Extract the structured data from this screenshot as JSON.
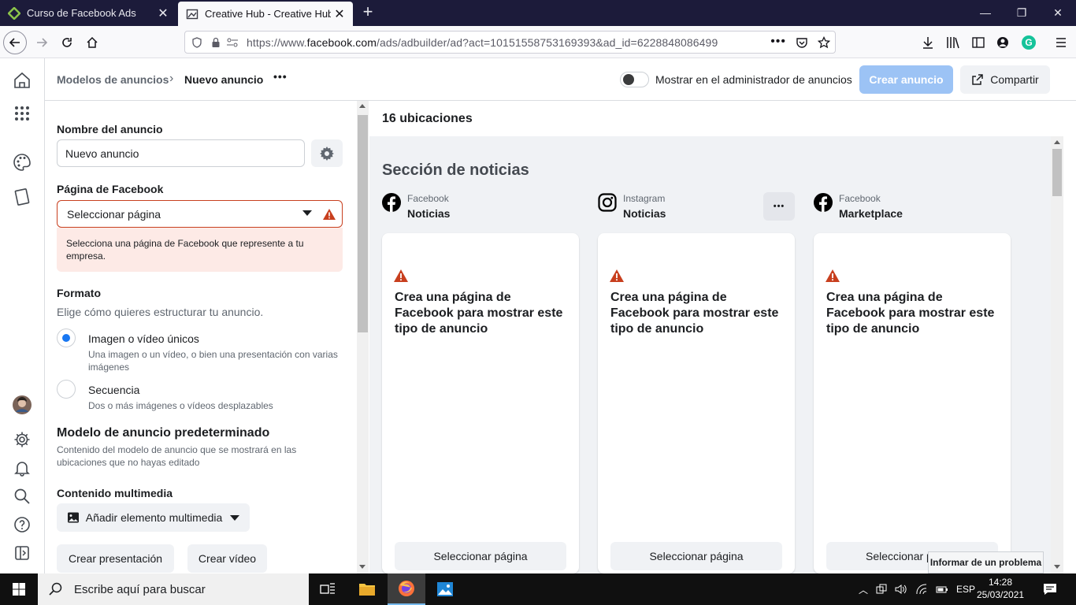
{
  "browser": {
    "tabs": [
      {
        "title": "Curso de Facebook Ads",
        "active": false
      },
      {
        "title": "Creative Hub - Creative Hub | N",
        "active": true
      }
    ],
    "url_prefix": "https://www.",
    "url_domain": "facebook.com",
    "url_rest": "/ads/adbuilder/ad?act=10151558753169393&ad_id=6228848086499"
  },
  "header": {
    "breadcrumb_parent": "Modelos de anuncios",
    "breadcrumb_current": "Nuevo anuncio",
    "toggle_label": "Mostrar en el administrador de anuncios",
    "create_button": "Crear anuncio",
    "share_button": "Compartir"
  },
  "form": {
    "ad_name_label": "Nombre del anuncio",
    "ad_name_value": "Nuevo anuncio",
    "fb_page_label": "Página de Facebook",
    "fb_page_select": "Seleccionar página",
    "fb_page_error": "Selecciona una página de Facebook que represente a tu empresa.",
    "format_label": "Formato",
    "format_help": "Elige cómo quieres estructurar tu anuncio.",
    "format_options": [
      {
        "label": "Imagen o vídeo únicos",
        "desc": "Una imagen o un vídeo, o bien una presentación con varias imágenes",
        "selected": true
      },
      {
        "label": "Secuencia",
        "desc": "Dos o más imágenes o vídeos desplazables",
        "selected": false
      }
    ],
    "default_model_label": "Modelo de anuncio predeterminado",
    "default_model_help": "Contenido del modelo de anuncio que se mostrará en las ubicaciones que no hayas editado",
    "media_label": "Contenido multimedia",
    "add_media_button": "Añadir elemento multimedia",
    "create_slideshow_button": "Crear presentación",
    "create_video_button": "Crear vídeo"
  },
  "preview": {
    "placements_count": "16 ubicaciones",
    "section_title": "Sección de noticias",
    "placements": [
      {
        "platform": "Facebook",
        "name": "Noticias",
        "icon": "facebook-icon"
      },
      {
        "platform": "Instagram",
        "name": "Noticias",
        "icon": "instagram-icon"
      },
      {
        "platform": "Facebook",
        "name": "Marketplace",
        "icon": "facebook-icon"
      }
    ],
    "card_message": "Crea una página de Facebook para mostrar este tipo de anuncio",
    "card_button": "Seleccionar página",
    "card_button_partial": "Seleccionar p"
  },
  "tooltip": "Informar de un problema",
  "taskbar": {
    "search_placeholder": "Escribe aquí para buscar",
    "lang": "ESP",
    "time": "14:28",
    "date": "25/03/2021"
  },
  "colors": {
    "primary_disabled": "#9cc3f5",
    "error_red": "#c83f1e",
    "error_bg": "#fdeae6",
    "radio_selected": "#1877f2"
  }
}
